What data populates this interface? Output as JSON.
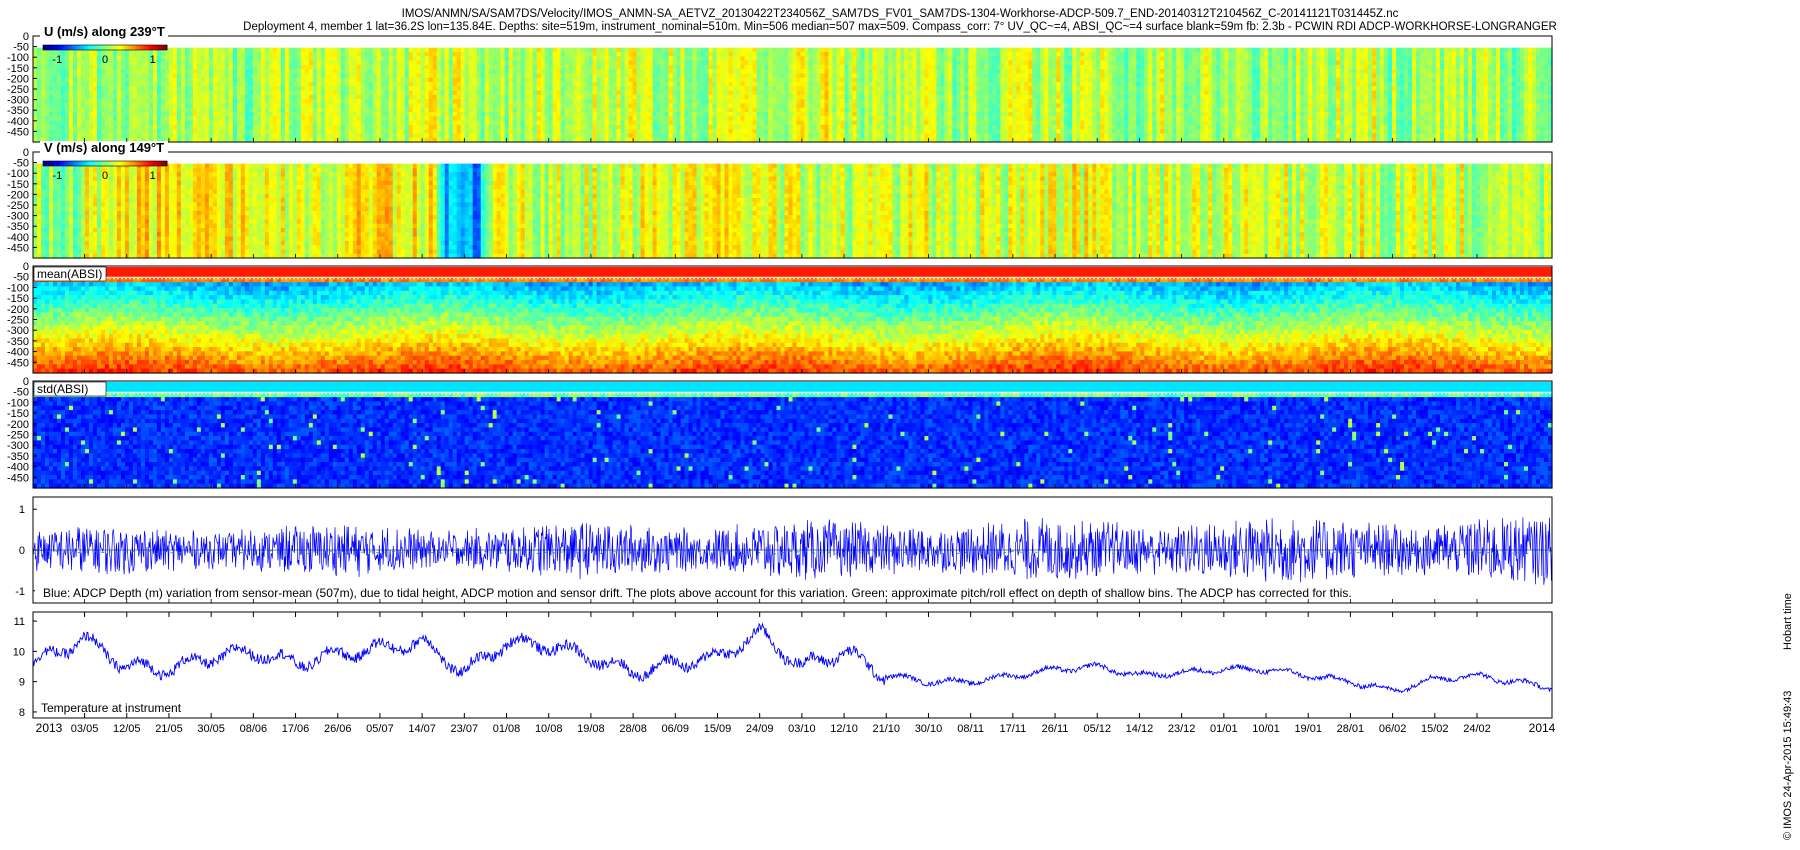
{
  "header": {
    "line1": "IMOS/ANMN/SA/SAM7DS/Velocity/IMOS_ANMN-SA_AETVZ_20130422T234056Z_SAM7DS_FV01_SAM7DS-1304-Workhorse-ADCP-509.7_END-20140312T210456Z_C-20141121T031445Z.nc",
    "line2": "Deployment 4, member 1 lat=36.2S lon=135.84E. Depths: site=519m, instrument_nominal=510m. Min=506 median=507 max=509. Compass_corr: 7° UV_QC~=4, ABSI_QC~=4 surface blank=59m fb: 2.3b - PCWIN RDI ADCP-WORKHORSE-LONGRANGER"
  },
  "footer": {
    "credit": "© IMOS 24-Apr-2015 15:49:43",
    "timezone": "Hobart time"
  },
  "colors": {
    "line_blue": "#0000ff",
    "line_green": "#00b000",
    "jet_low": "#00008f",
    "jet_mid": "#7fff7f",
    "jet_high": "#800000"
  },
  "chart_data": [
    {
      "type": "heatmap",
      "title": "U (m/s) along 239°T",
      "colorbar_ticks": [
        "-1",
        "0",
        "1"
      ],
      "colorbar_range": [
        -1.3,
        1.3
      ],
      "y_ticks": [
        "-50",
        "-100",
        "-150",
        "-200",
        "-250",
        "-300",
        "-350",
        "-400",
        "-450"
      ],
      "ylim": [
        0,
        -500
      ],
      "x_tick_labels": [
        "03/05",
        "12/05",
        "21/05",
        "30/05",
        "08/06",
        "17/06",
        "26/06",
        "05/07",
        "14/07",
        "23/07",
        "01/08",
        "10/08",
        "19/08",
        "28/08",
        "06/09",
        "15/09",
        "24/09",
        "03/10",
        "12/10",
        "21/10",
        "30/10",
        "08/11",
        "17/11",
        "26/11",
        "05/12",
        "14/12",
        "23/12",
        "01/01",
        "10/01",
        "19/01",
        "28/01",
        "06/02",
        "15/02",
        "24/02"
      ],
      "x_start": "22/04/2013",
      "x_end": "12/03/2014",
      "x_year_start": "2013",
      "x_year_end": "2014",
      "value_profile": [
        0.05,
        0.1,
        0.05,
        0.15,
        0.1,
        0.2,
        0.15,
        0.2,
        0.25,
        0.2,
        0.15,
        0.25,
        0.3,
        0.2,
        0.15,
        0.2,
        0.25,
        0.3,
        0.2,
        0.15,
        0.1,
        0.15,
        0.2,
        0.15,
        0.1,
        0.2,
        0.15,
        0.1,
        0.15,
        0.2,
        0.1,
        0.15,
        0.1,
        0.05
      ]
    },
    {
      "type": "heatmap",
      "title": "V (m/s) along 149°T",
      "colorbar_ticks": [
        "-1",
        "0",
        "1"
      ],
      "colorbar_range": [
        -1.3,
        1.3
      ],
      "y_ticks": [
        "-50",
        "-100",
        "-150",
        "-200",
        "-250",
        "-300",
        "-350",
        "-400",
        "-450"
      ],
      "ylim": [
        0,
        -500
      ],
      "value_profile": [
        0.1,
        0.3,
        0.5,
        0.55,
        0.4,
        0.3,
        0.35,
        0.5,
        0.4,
        -0.1,
        0.3,
        0.2,
        0.25,
        0.3,
        0.35,
        0.45,
        0.3,
        0.25,
        0.2,
        0.3,
        0.2,
        0.25,
        0.3,
        0.35,
        0.2,
        0.25,
        0.3,
        0.2,
        0.25,
        0.3,
        0.2,
        0.25,
        0.2,
        0.15
      ]
    },
    {
      "type": "heatmap",
      "title": "mean(ABSI)",
      "y_ticks": [
        "-50",
        "-100",
        "-150",
        "-200",
        "-250",
        "-300",
        "-350",
        "-400",
        "-450"
      ],
      "ylim": [
        0,
        -500
      ]
    },
    {
      "type": "heatmap",
      "title": "std(ABSI)",
      "y_ticks": [
        "-50",
        "-100",
        "-150",
        "-200",
        "-250",
        "-300",
        "-350",
        "-400",
        "-450"
      ],
      "ylim": [
        0,
        -500
      ]
    },
    {
      "type": "line",
      "y_ticks": [
        "1",
        "0",
        "-1"
      ],
      "ylim": [
        -1.3,
        1.3
      ],
      "annotation": "Blue: ADCP Depth (m) variation from sensor-mean (507m), due to tidal height, ADCP motion and sensor drift. The plots above account for this variation. Green: approximate pitch/roll effect on depth of shallow bins. The ADCP has corrected for this.",
      "series": [
        {
          "color": "#0000ff",
          "amplitude": 0.6
        },
        {
          "color": "#00b000",
          "amplitude": 0.05
        }
      ]
    },
    {
      "type": "line",
      "y_ticks": [
        "11",
        "10",
        "9",
        "8"
      ],
      "ylim": [
        7.8,
        11.3
      ],
      "annotation": "Temperature at instrument",
      "series": [
        {
          "color": "#0000ff",
          "x": [
            "22/04",
            "03/05",
            "12/05",
            "21/05",
            "30/05",
            "08/06",
            "17/06",
            "26/06",
            "05/07",
            "14/07",
            "23/07",
            "01/08",
            "10/08",
            "19/08",
            "28/08",
            "06/09",
            "15/09",
            "24/09",
            "03/10",
            "12/10",
            "21/10",
            "30/10",
            "08/11",
            "17/11",
            "26/11",
            "05/12",
            "14/12",
            "23/12",
            "01/01",
            "10/01",
            "19/01",
            "28/01",
            "06/02",
            "15/02",
            "24/02",
            "12/03"
          ],
          "y": [
            9.6,
            10.4,
            9.5,
            9.4,
            9.8,
            10.0,
            9.6,
            9.9,
            10.1,
            10.3,
            9.3,
            10.3,
            10.2,
            9.8,
            9.3,
            9.6,
            9.8,
            10.6,
            9.5,
            10.0,
            9.2,
            9.0,
            9.0,
            9.2,
            9.4,
            9.5,
            9.2,
            9.3,
            9.4,
            9.4,
            9.2,
            9.0,
            8.7,
            9.1,
            9.2,
            8.8
          ]
        }
      ]
    }
  ]
}
